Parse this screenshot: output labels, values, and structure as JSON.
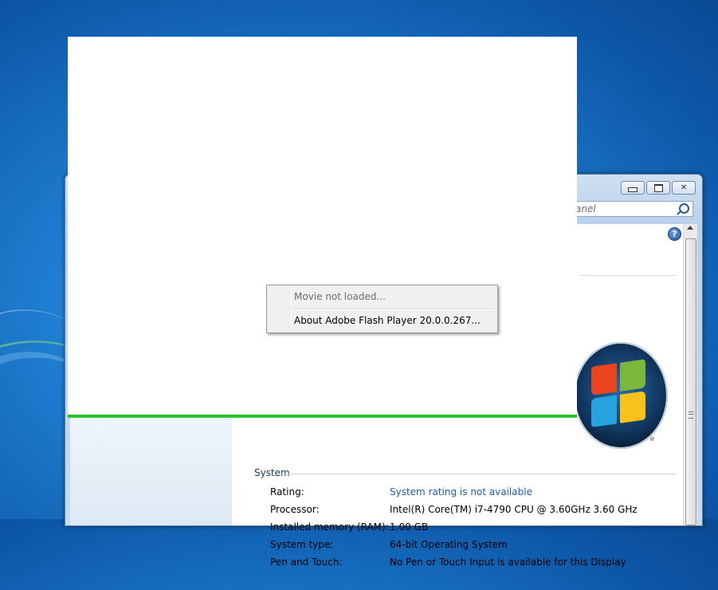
{
  "window": {
    "search_placeholder": "anel",
    "help_glyph": "?"
  },
  "system": {
    "section_title": "System",
    "rows": [
      {
        "label": "Rating:",
        "value": "System rating is not available",
        "link": true
      },
      {
        "label": "Processor:",
        "value": "Intel(R) Core(TM) i7-4790 CPU @ 3.60GHz   3.60 GHz",
        "link": false
      },
      {
        "label": "Installed memory (RAM):",
        "value": "1.00 GB",
        "link": false
      },
      {
        "label": "System type:",
        "value": "64-bit Operating System",
        "link": false
      },
      {
        "label": "Pen and Touch:",
        "value": "No Pen or Touch Input is available for this Display",
        "link": false
      }
    ],
    "logo_reg": "®"
  },
  "context_menu": {
    "items": [
      {
        "label": "Movie not loaded...",
        "enabled": false
      },
      {
        "label": "About Adobe Flash Player 20.0.0.267...",
        "enabled": true
      }
    ]
  },
  "colors": {
    "progress": "#24c52f",
    "link": "#1a5fb4"
  }
}
